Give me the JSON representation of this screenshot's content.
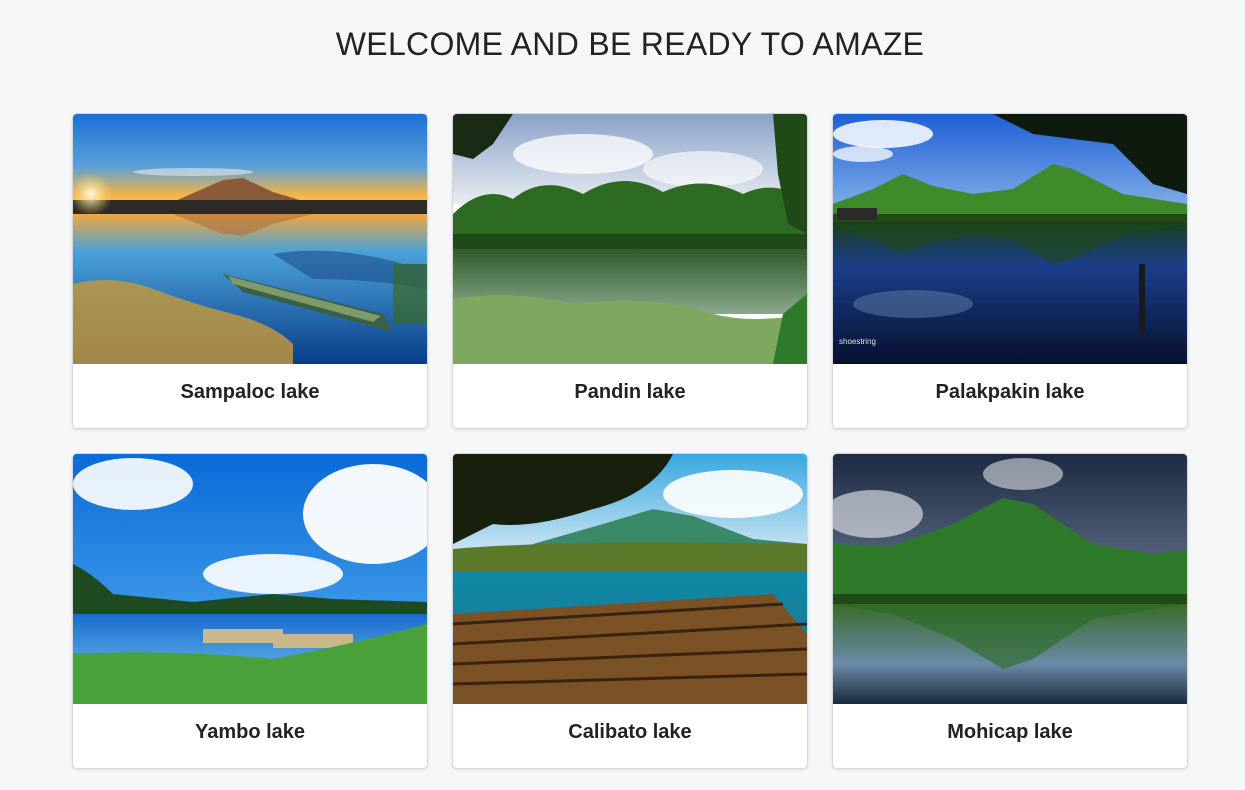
{
  "header": {
    "title": "WELCOME AND BE READY TO AMAZE"
  },
  "colors": {
    "background": "#f6f7f9",
    "card": "#ffffff",
    "text": "#222222"
  },
  "cards": [
    {
      "title": "Sampaloc lake",
      "image": "sunset-lake-with-boat-and-mountain"
    },
    {
      "title": "Pandin lake",
      "image": "green-forest-lake-with-lily-pads"
    },
    {
      "title": "Palakpakin lake",
      "image": "blue-lake-reflecting-green-hills"
    },
    {
      "title": "Yambo lake",
      "image": "blue-lake-with-rafts-and-grass"
    },
    {
      "title": "Calibato lake",
      "image": "bamboo-raft-on-turquoise-lake"
    },
    {
      "title": "Mohicap lake",
      "image": "green-mountain-reflected-in-lake"
    }
  ]
}
